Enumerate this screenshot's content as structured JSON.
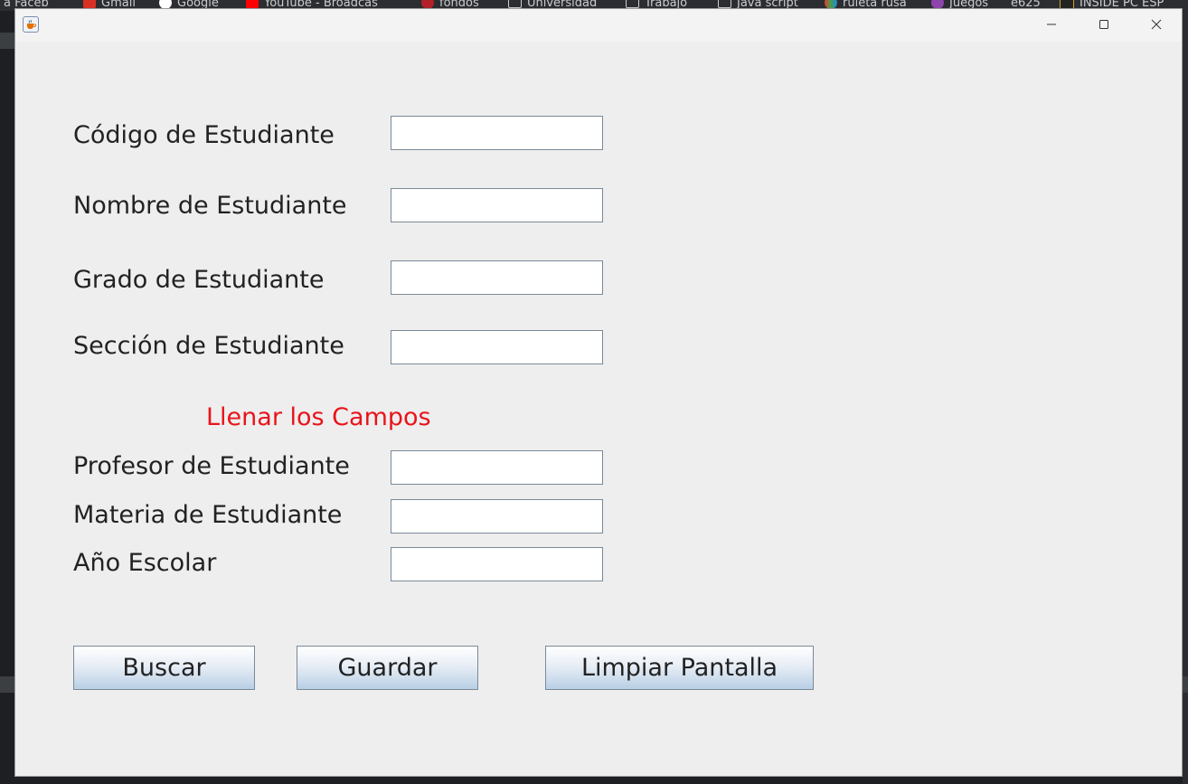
{
  "window": {
    "title": "",
    "icon": "java-cup-icon",
    "controls": [
      "minimize-icon",
      "maximize-icon",
      "close-icon"
    ]
  },
  "form": {
    "fields": [
      {
        "label": "Código de Estudiante",
        "value": ""
      },
      {
        "label": "Nombre de Estudiante",
        "value": ""
      },
      {
        "label": "Grado de Estudiante",
        "value": ""
      },
      {
        "label": "Sección de Estudiante",
        "value": ""
      },
      {
        "label": "Profesor de Estudiante",
        "value": ""
      },
      {
        "label": "Materia de Estudiante",
        "value": ""
      },
      {
        "label": "Año Escolar",
        "value": ""
      }
    ],
    "error_message": "Llenar los Campos",
    "error_color": "#e8141b"
  },
  "buttons": {
    "search": "Buscar",
    "save": "Guardar",
    "clear": "Limpiar Pantalla"
  },
  "background": {
    "bookmarks": [
      "a Faceb",
      "Gmail",
      "Google",
      "YouTube - Broadcas",
      "fondos",
      "Universidad",
      "Trabajo",
      "Java script",
      "ruleta rusa",
      "Juegos",
      "e625",
      "INSIDE PC ESP"
    ]
  }
}
